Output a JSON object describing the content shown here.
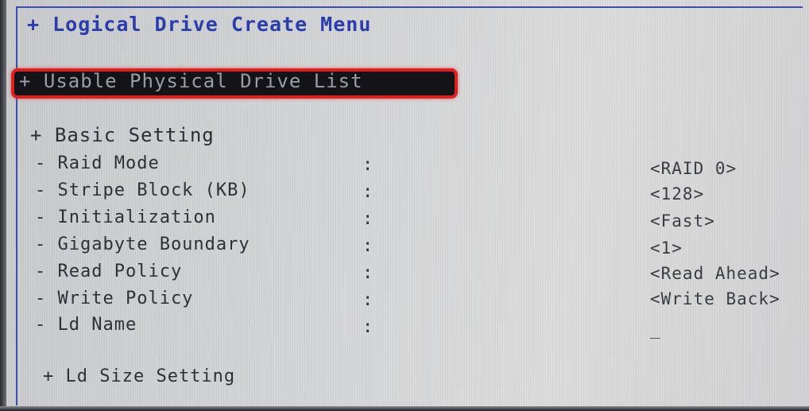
{
  "menu": {
    "title": "+ Logical Drive Create Menu",
    "usable_drive_list": "+ Usable Physical Drive List",
    "basic_setting": "+ Basic Setting",
    "ld_size_setting": "+ Ld Size Setting",
    "highlight_color": "#e01f1f",
    "title_color": "#2a3dad"
  },
  "settings": [
    {
      "label": "- Raid Mode",
      "colon": ":",
      "value": "<RAID 0>"
    },
    {
      "label": "- Stripe Block (KB)",
      "colon": ":",
      "value": "<128>"
    },
    {
      "label": "- Initialization",
      "colon": ":",
      "value": "<Fast>"
    },
    {
      "label": "- Gigabyte Boundary",
      "colon": ":",
      "value": "<1>"
    },
    {
      "label": "- Read Policy",
      "colon": ":",
      "value": "<Read Ahead>"
    },
    {
      "label": "- Write Policy",
      "colon": ":",
      "value": "<Write Back>"
    },
    {
      "label": "- Ld Name",
      "colon": ":",
      "value": "_"
    }
  ]
}
